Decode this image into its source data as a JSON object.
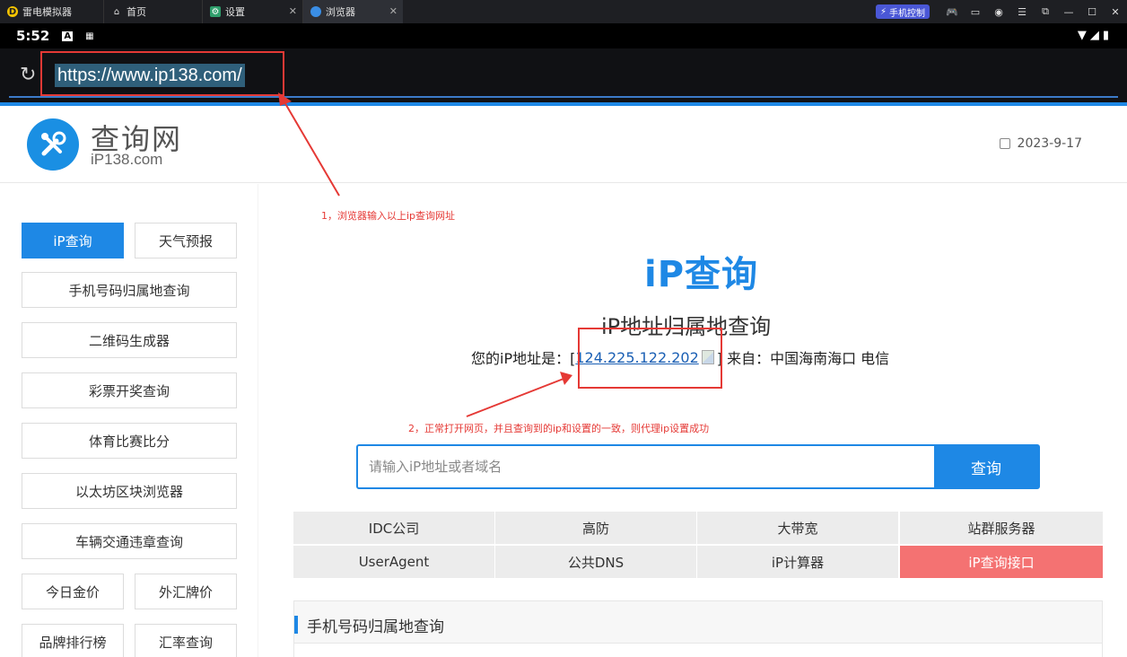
{
  "emulator": {
    "tabs": [
      {
        "label": "雷电模拟器"
      },
      {
        "label": "首页"
      },
      {
        "label": "设置"
      },
      {
        "label": "浏览器"
      }
    ],
    "phone_control": "手机控制"
  },
  "status_bar": {
    "time": "5:52"
  },
  "browser": {
    "url": "https://www.ip138.com/"
  },
  "site": {
    "logo_title": "查询网",
    "logo_sub": "iP138.com",
    "date": "2023-9-17"
  },
  "sidebar": {
    "items": [
      {
        "label": "iP查询"
      },
      {
        "label": "天气预报"
      },
      {
        "label": "手机号码归属地查询"
      },
      {
        "label": "二维码生成器"
      },
      {
        "label": "彩票开奖查询"
      },
      {
        "label": "体育比赛比分"
      },
      {
        "label": "以太坊区块浏览器"
      },
      {
        "label": "车辆交通违章查询"
      },
      {
        "label": "今日金价"
      },
      {
        "label": "外汇牌价"
      },
      {
        "label": "品牌排行榜"
      },
      {
        "label": "汇率查询"
      }
    ]
  },
  "main": {
    "title": "iP查询",
    "subtitle": "iP地址归属地查询",
    "ip_prefix": "您的iP地址是：[",
    "ip_value": "124.225.122.202",
    "ip_suffix": "] 来自：中国海南海口 电信",
    "search_placeholder": "请输入iP地址或者域名",
    "search_button": "查询",
    "links": [
      {
        "label": "IDC公司"
      },
      {
        "label": "高防"
      },
      {
        "label": "大带宽"
      },
      {
        "label": "站群服务器"
      },
      {
        "label": "UserAgent"
      },
      {
        "label": "公共DNS"
      },
      {
        "label": "iP计算器"
      },
      {
        "label": "iP查询接口"
      }
    ],
    "section_title": "手机号码归属地查询"
  },
  "annotations": {
    "note1": "1，浏览器输入以上ip查询网址",
    "note2": "2，正常打开网页，并且查询到的ip和设置的一致，则代理ip设置成功"
  },
  "colors": {
    "accent": "#1e88e5",
    "annotation_red": "#e53935",
    "highlight_link": "#f47272"
  }
}
